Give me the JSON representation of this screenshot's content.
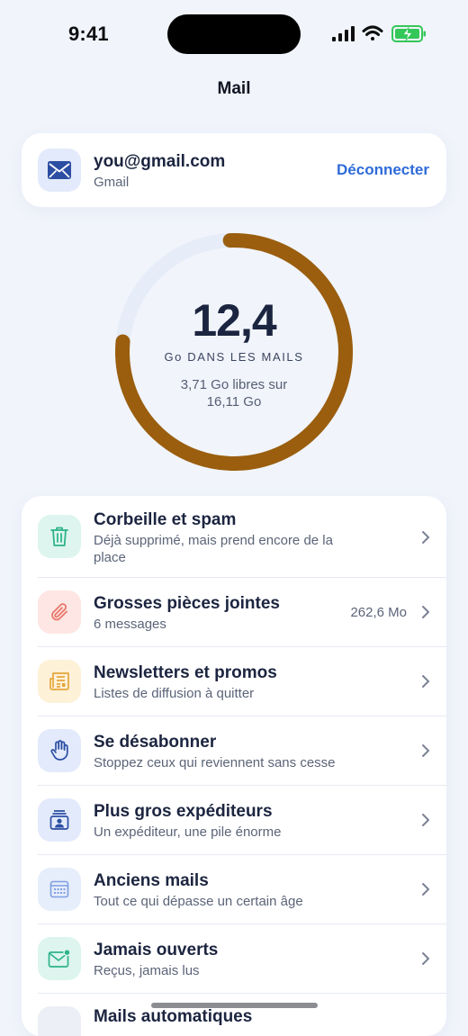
{
  "status_bar": {
    "time": "9:41"
  },
  "nav": {
    "title": "Mail"
  },
  "account": {
    "email": "you@gmail.com",
    "provider": "Gmail",
    "disconnect_label": "Déconnecter",
    "icon": "envelope-icon"
  },
  "storage": {
    "value": "12,4",
    "unit_label": "Go DANS LES MAILS",
    "free_text": "3,71 Go libres sur 16,11 Go",
    "used_fraction": 0.77,
    "ring_color": "#9a5e0e",
    "track_color": "#e6ecf8"
  },
  "categories": [
    {
      "title": "Corbeille et spam",
      "subtitle": "Déjà supprimé, mais prend encore de la place",
      "meta": "",
      "icon": "trash-icon",
      "icon_bg": "#ddf5ee",
      "icon_color": "#2fb38a"
    },
    {
      "title": "Grosses pièces jointes",
      "subtitle": "6 messages",
      "meta": "262,6 Mo",
      "icon": "paperclip-icon",
      "icon_bg": "#fde6e3",
      "icon_color": "#e8776b"
    },
    {
      "title": "Newsletters et promos",
      "subtitle": "Listes de diffusion à quitter",
      "meta": "",
      "icon": "newspaper-icon",
      "icon_bg": "#fdf1d8",
      "icon_color": "#e5a63a"
    },
    {
      "title": "Se désabonner",
      "subtitle": "Stoppez ceux qui reviennent sans cesse",
      "meta": "",
      "icon": "hand-icon",
      "icon_bg": "#e3eafb",
      "icon_color": "#2c4ea3"
    },
    {
      "title": "Plus gros expéditeurs",
      "subtitle": "Un expéditeur, une pile énorme",
      "meta": "",
      "icon": "sender-icon",
      "icon_bg": "#e3eafb",
      "icon_color": "#2c4ea3"
    },
    {
      "title": "Anciens mails",
      "subtitle": "Tout ce qui dépasse un certain âge",
      "meta": "",
      "icon": "calendar-icon",
      "icon_bg": "#e6edfb",
      "icon_color": "#7f9ee0"
    },
    {
      "title": "Jamais ouverts",
      "subtitle": "Reçus, jamais lus",
      "meta": "",
      "icon": "unread-mail-icon",
      "icon_bg": "#ddf5ee",
      "icon_color": "#2fb38a"
    },
    {
      "title": "Mails automatiques",
      "subtitle": "",
      "meta": "",
      "icon": "robot-icon",
      "icon_bg": "#eceff5",
      "icon_color": "#6b7385"
    }
  ]
}
